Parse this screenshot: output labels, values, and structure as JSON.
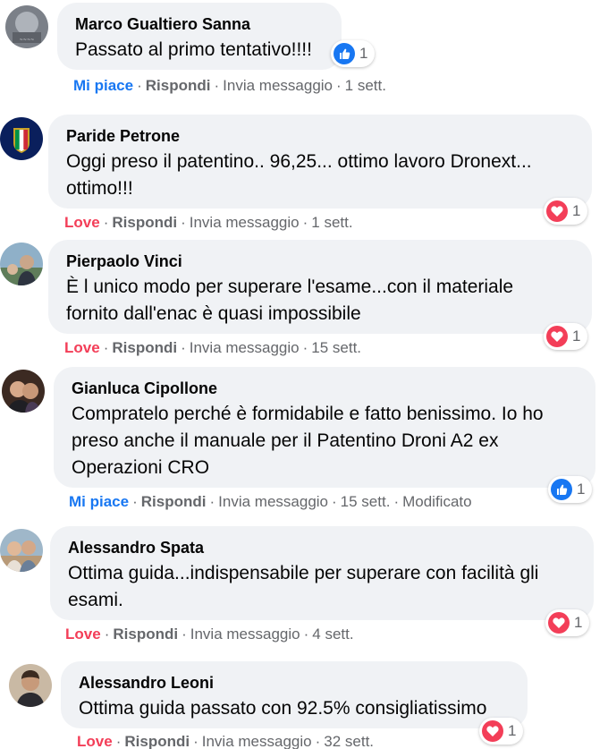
{
  "comments": [
    {
      "author": "Marco Gualtiero Sanna",
      "text_lines": [
        "Passato al primo tentativo!!!!"
      ],
      "action": "Mi piace",
      "reply": "Rispondi",
      "message": "Invia messaggio",
      "time": "1 sett.",
      "edited": "",
      "reaction_icon": "like-icon",
      "reaction_count": "1"
    },
    {
      "author": "Paride Petrone",
      "text_lines": [
        "Oggi preso il patentino.. 96,25... ottimo lavoro Dronext...",
        "ottimo!!!"
      ],
      "action": "Love",
      "reply": "Rispondi",
      "message": "Invia messaggio",
      "time": "1 sett.",
      "edited": "",
      "reaction_icon": "heart-icon",
      "reaction_count": "1"
    },
    {
      "author": "Pierpaolo Vinci",
      "text_lines": [
        "È l unico modo per superare l'esame...con il materiale",
        "fornito dall'enac è quasi impossibile"
      ],
      "action": "Love",
      "reply": "Rispondi",
      "message": "Invia messaggio",
      "time": "15 sett.",
      "edited": "",
      "reaction_icon": "heart-icon",
      "reaction_count": "1"
    },
    {
      "author": "Gianluca Cipollone",
      "text_lines": [
        "Compratelo perché è formidabile e fatto benissimo. Io ho",
        "preso anche il manuale per il Patentino Droni A2 ex",
        "Operazioni CRO"
      ],
      "action": "Mi piace",
      "reply": "Rispondi",
      "message": "Invia messaggio",
      "time": "15 sett.",
      "edited": "Modificato",
      "reaction_icon": "like-icon",
      "reaction_count": "1"
    },
    {
      "author": "Alessandro Spata",
      "text_lines": [
        "Ottima guida...indispensabile per superare con facilità gli",
        "esami."
      ],
      "action": "Love",
      "reply": "Rispondi",
      "message": "Invia messaggio",
      "time": "4 sett.",
      "edited": "",
      "reaction_icon": "heart-icon",
      "reaction_count": "1"
    },
    {
      "author": "Alessandro Leoni",
      "text_lines": [
        "Ottima guida passato con 92.5% consigliatissimo"
      ],
      "action": "Love",
      "reply": "Rispondi",
      "message": "Invia messaggio",
      "time": "32 sett.",
      "edited": "",
      "reaction_icon": "heart-icon",
      "reaction_count": "1"
    }
  ],
  "colors": {
    "bubble": "#f0f2f5",
    "like_blue": "#1877f2",
    "love_red": "#f33e58",
    "meta_gray": "#65676b"
  }
}
